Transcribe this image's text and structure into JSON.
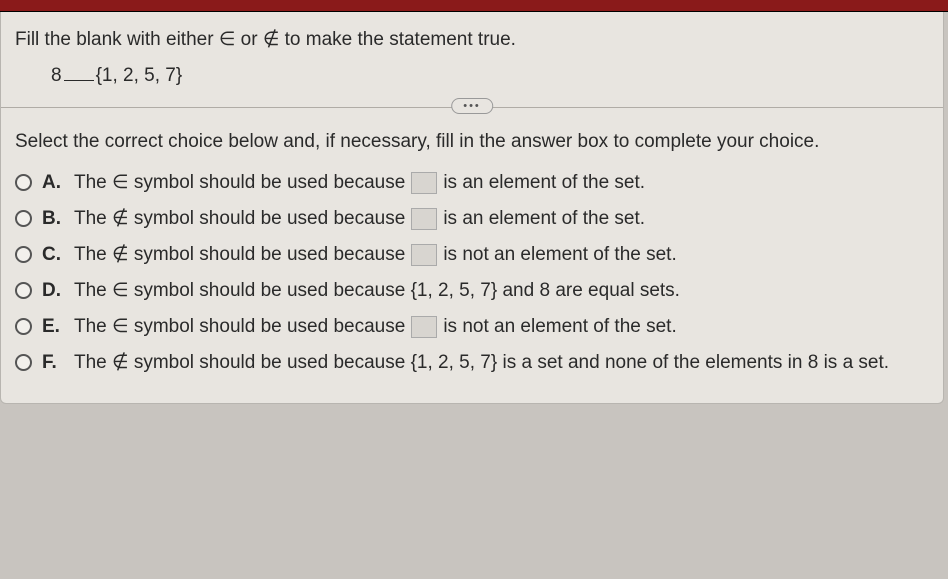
{
  "question": {
    "instruction": "Fill the blank with either ∈ or ∉ to make the statement true.",
    "lhs": "8",
    "rhs": "{1, 2, 5, 7}"
  },
  "ellipsis": "•••",
  "select_instruction": "Select the correct choice below and, if necessary, fill in the answer box to complete your choice.",
  "choices": [
    {
      "letter": "A.",
      "pre": "The ∈ symbol should be used because",
      "has_box": true,
      "post": "is an element of the set."
    },
    {
      "letter": "B.",
      "pre": "The ∉ symbol should be used because",
      "has_box": true,
      "post": "is an element of the set."
    },
    {
      "letter": "C.",
      "pre": "The ∉ symbol should be used because",
      "has_box": true,
      "post": "is not an element of the set."
    },
    {
      "letter": "D.",
      "pre": "The ∈ symbol should be used because {1, 2, 5, 7} and 8 are equal sets.",
      "has_box": false,
      "post": ""
    },
    {
      "letter": "E.",
      "pre": "The ∈ symbol should be used because",
      "has_box": true,
      "post": "is not an element of the set."
    },
    {
      "letter": "F.",
      "pre": "The ∉ symbol should be used because {1, 2, 5, 7} is a set and none of the elements in 8 is a set.",
      "has_box": false,
      "post": ""
    }
  ]
}
